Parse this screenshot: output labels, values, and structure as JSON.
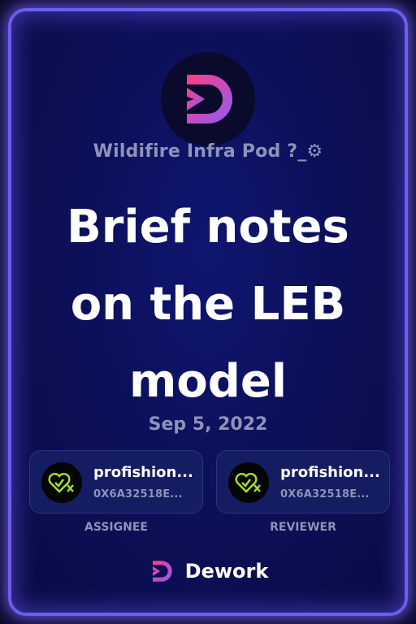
{
  "card": {
    "org_name": "Wildifire Infra Pod ?_⚙",
    "title": "Brief notes on the LEB model",
    "date": "Sep 5, 2022"
  },
  "assignee": {
    "name": "profishion...",
    "address": "0X6A32518E...",
    "role_label": "ASSIGNEE"
  },
  "reviewer": {
    "name": "profishion...",
    "address": "0X6A32518E...",
    "role_label": "REVIEWER"
  },
  "brand": {
    "name": "Dework"
  },
  "colors": {
    "background": "#0c105a",
    "border_glow": "#6e5df2",
    "muted_text": "#8e93b9",
    "accent_pink": "#ea3e8c",
    "accent_purple": "#8a5cf6",
    "avatar_green": "#a6e22e"
  },
  "icons": [
    "dework-logo-icon",
    "heart-x-avatar-icon"
  ]
}
